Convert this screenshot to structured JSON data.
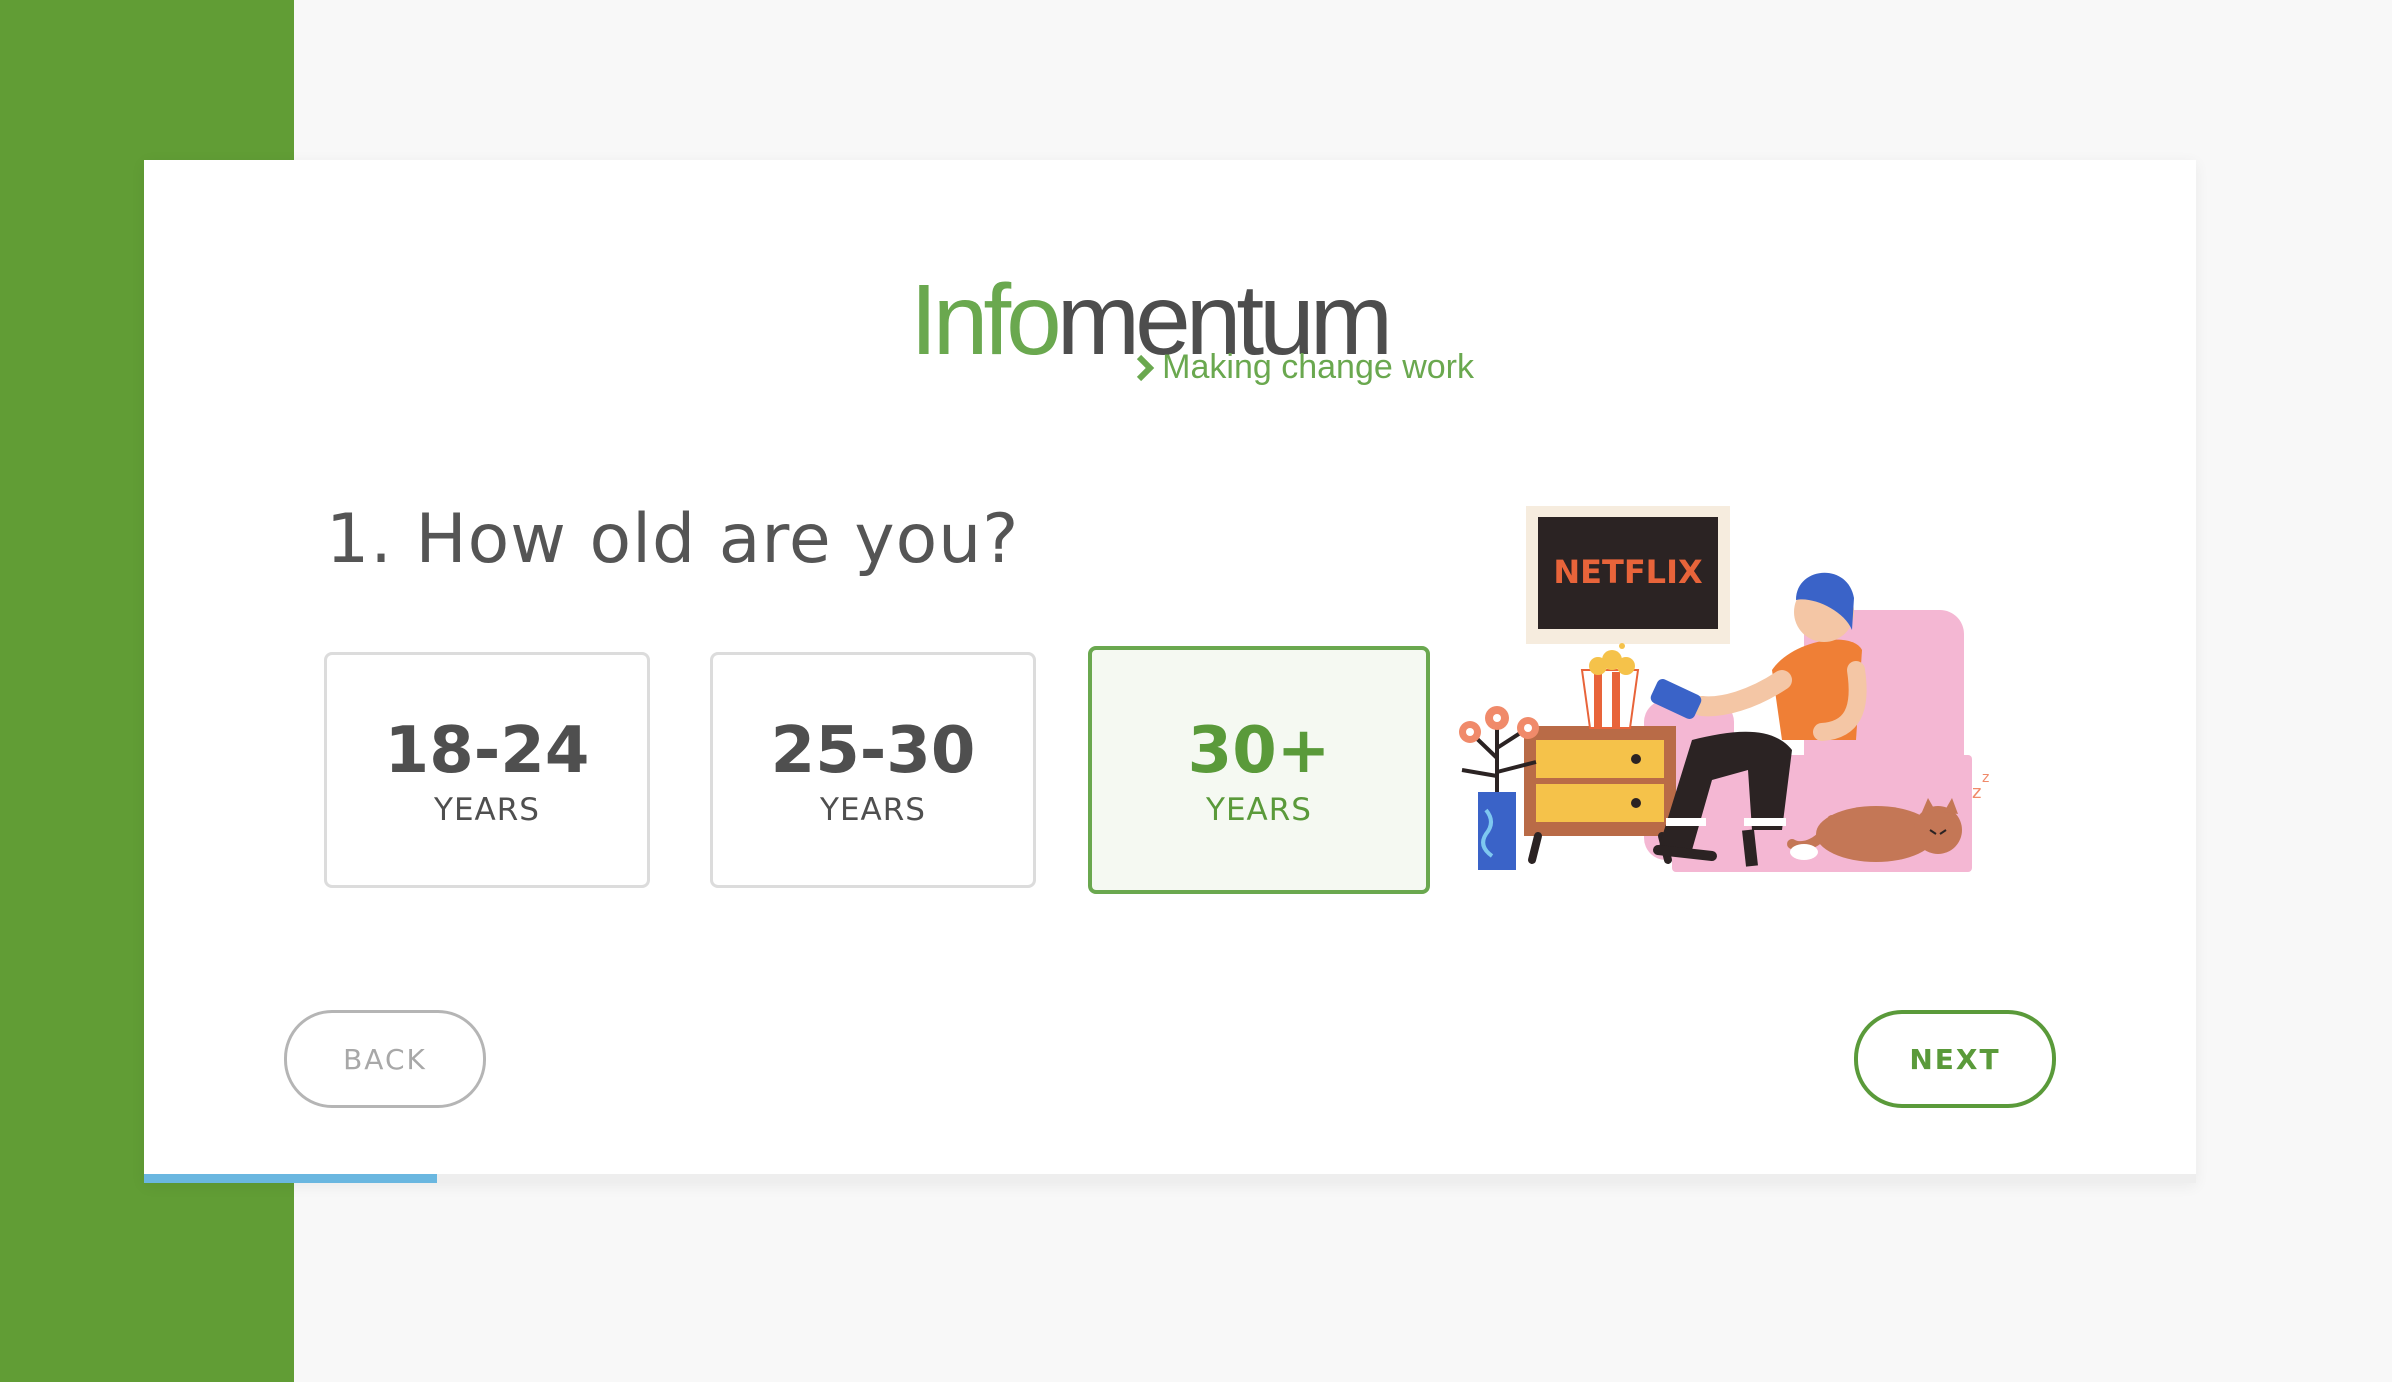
{
  "brand": {
    "name_part1": "Info",
    "name_part2": "mentum",
    "tagline": "Making change work"
  },
  "question": {
    "text": "1. How old are you?"
  },
  "options": [
    {
      "value": "18-24",
      "unit": "YEARS",
      "selected": false
    },
    {
      "value": "25-30",
      "unit": "YEARS",
      "selected": false
    },
    {
      "value": "30+",
      "unit": "YEARS",
      "selected": true
    }
  ],
  "illustration": {
    "tv_label": "NETFLIX"
  },
  "nav": {
    "back_label": "BACK",
    "next_label": "NEXT"
  },
  "progress": {
    "fraction": 0.143
  },
  "colors": {
    "brand_green": "#619d35",
    "accent_green": "#6aa84f",
    "progress_blue": "#6ab7e0"
  }
}
